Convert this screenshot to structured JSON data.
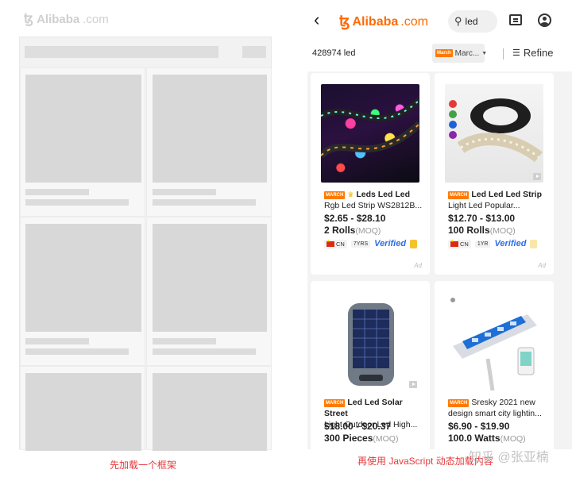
{
  "left_panel": {
    "logo": {
      "icon": "alibaba-logo-icon",
      "brand": "Alibaba",
      "domain": ".com"
    },
    "caption": "先加载一个框架"
  },
  "right_panel": {
    "nav": {
      "back_icon": "chevron-left-icon",
      "logo": {
        "brand": "Alibaba",
        "domain": ".com"
      },
      "search_query": "led",
      "message_icon": "message-icon",
      "user_icon": "user-icon"
    },
    "toolbar": {
      "result_count": "428974 led",
      "filter_tag": "March",
      "filter_label": "Marc...",
      "refine_label": "Refine"
    },
    "products": [
      {
        "tag": "MARCH",
        "title_line1": "Leds Led Led",
        "title_line2": "Rgb Led Strip WS2812B...",
        "price": "$2.65 - $28.10",
        "moq_qty": "2 Rolls",
        "moq_unit": "(MOQ)",
        "country": "CN",
        "years": "7YRS",
        "verified": "Verified",
        "ad": "Ad"
      },
      {
        "tag": "MARCH",
        "title_line1": "Led Led Led Strip",
        "title_line2": "Light Led Popular...",
        "price": "$12.70 - $13.00",
        "moq_qty": "100 Rolls",
        "moq_unit": "(MOQ)",
        "country": "CN",
        "years": "1YR",
        "verified": "Verified",
        "ad": "Ad"
      },
      {
        "tag": "MARCH",
        "title_line1": "Led Led Solar Street",
        "title_line2": "Light Outdoor Led High...",
        "price": "$18.00 - $20.37",
        "moq_qty": "300 Pieces",
        "moq_unit": "(MOQ)"
      },
      {
        "tag": "MARCH",
        "title_line1": "Sresky 2021 new",
        "title_line2": "design smart city lightin...",
        "price": "$6.90 - $19.90",
        "moq_qty": "100.0 Watts",
        "moq_unit": "(MOQ)"
      }
    ],
    "caption": "再使用 JavaScript 动态加载内容"
  },
  "watermark": "知乎 @张亚楠"
}
